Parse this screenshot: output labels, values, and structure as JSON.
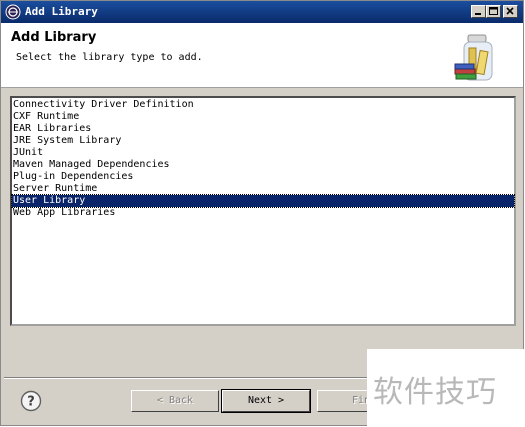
{
  "window": {
    "title": "Add Library"
  },
  "header": {
    "title": "Add Library",
    "description": "Select the library type to add."
  },
  "library_types": [
    "Connectivity Driver Definition",
    "CXF Runtime",
    "EAR Libraries",
    "JRE System Library",
    "JUnit",
    "Maven Managed Dependencies",
    "Plug-in Dependencies",
    "Server Runtime",
    "User Library",
    "Web App Libraries"
  ],
  "selected_index": 8,
  "buttons": {
    "back": "< Back",
    "next": "Next >",
    "finish": "Fin"
  },
  "watermark": "软件技巧"
}
